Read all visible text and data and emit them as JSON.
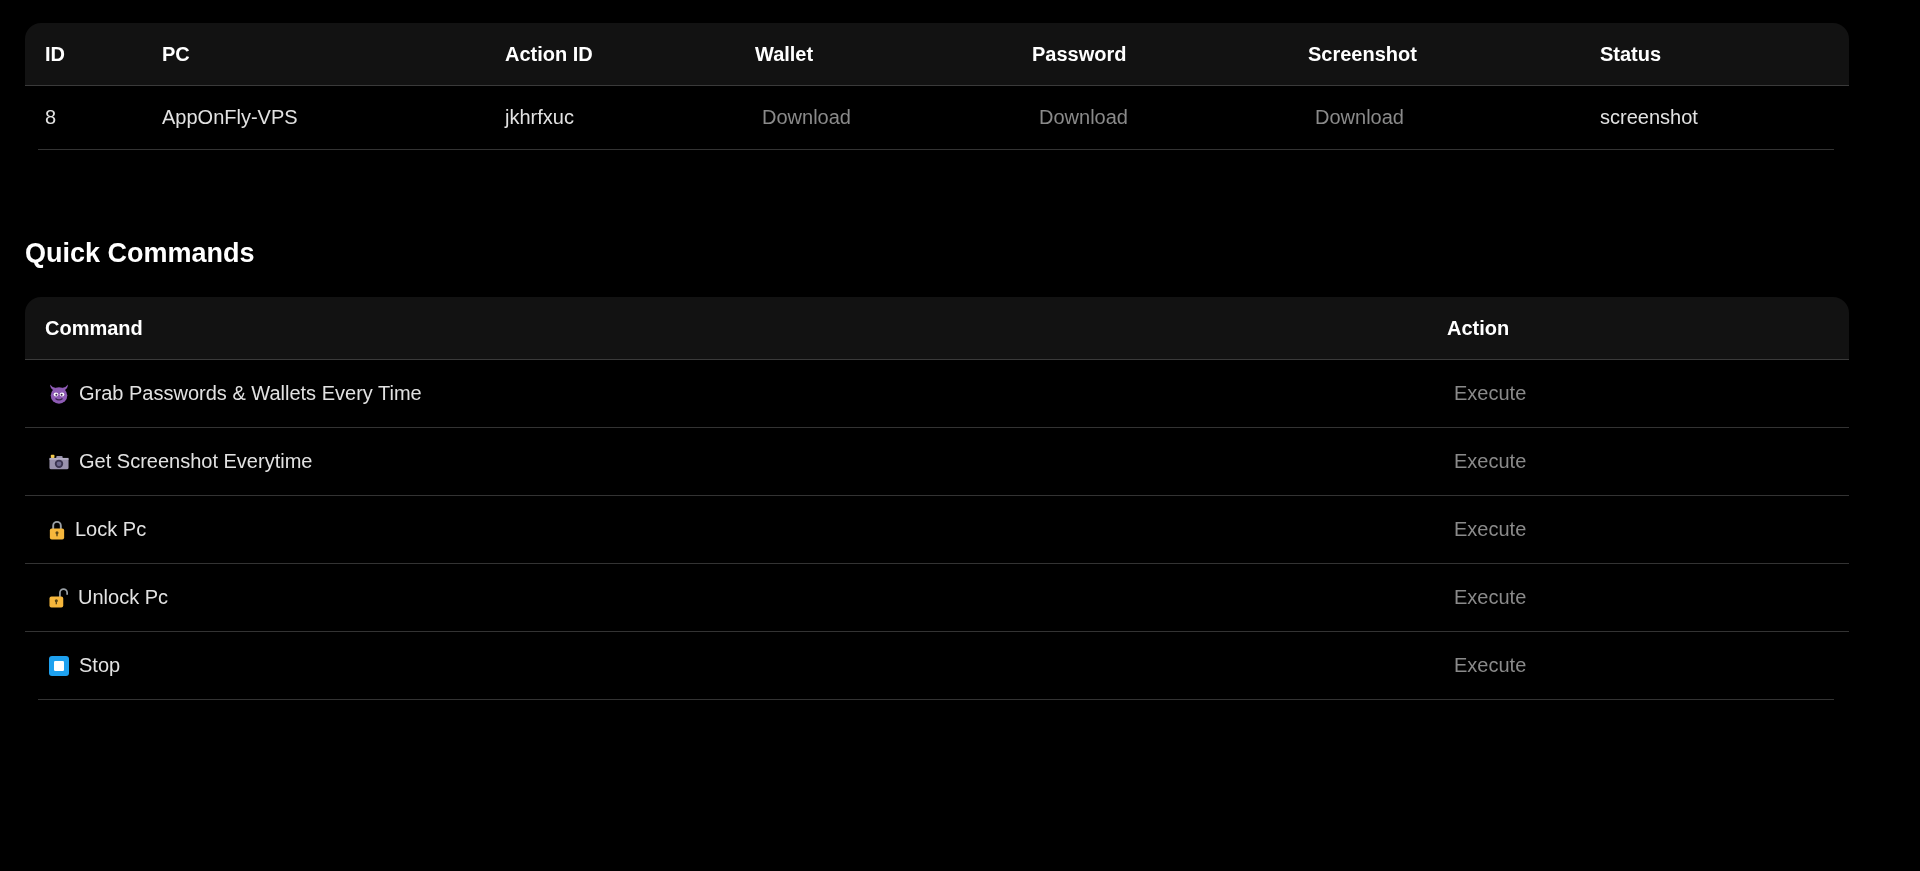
{
  "devices_table": {
    "columns": [
      "ID",
      "PC",
      "Action ID",
      "Wallet",
      "Password",
      "Screenshot",
      "Status"
    ],
    "rows": [
      {
        "cells": [
          {
            "kind": "text",
            "text": "8"
          },
          {
            "kind": "text",
            "text": "AppOnFly-VPS"
          },
          {
            "kind": "text",
            "text": "jkhrfxuc"
          },
          {
            "kind": "link",
            "text": "Download"
          },
          {
            "kind": "link",
            "text": "Download"
          },
          {
            "kind": "link",
            "text": "Download"
          },
          {
            "kind": "text",
            "text": "screenshot"
          }
        ]
      }
    ]
  },
  "quick_commands": {
    "title": "Quick Commands",
    "columns": [
      "Command",
      "Action"
    ],
    "commands": [
      {
        "kind": "devil",
        "label": "Grab Passwords & Wallets Every Time",
        "action": "Execute"
      },
      {
        "kind": "camera",
        "label": "Get Screenshot Everytime",
        "action": "Execute"
      },
      {
        "kind": "lock",
        "label": "Lock Pc",
        "action": "Execute"
      },
      {
        "kind": "unlock",
        "label": "Unlock Pc",
        "action": "Execute"
      },
      {
        "kind": "stop",
        "label": "Stop",
        "action": "Execute"
      }
    ]
  }
}
